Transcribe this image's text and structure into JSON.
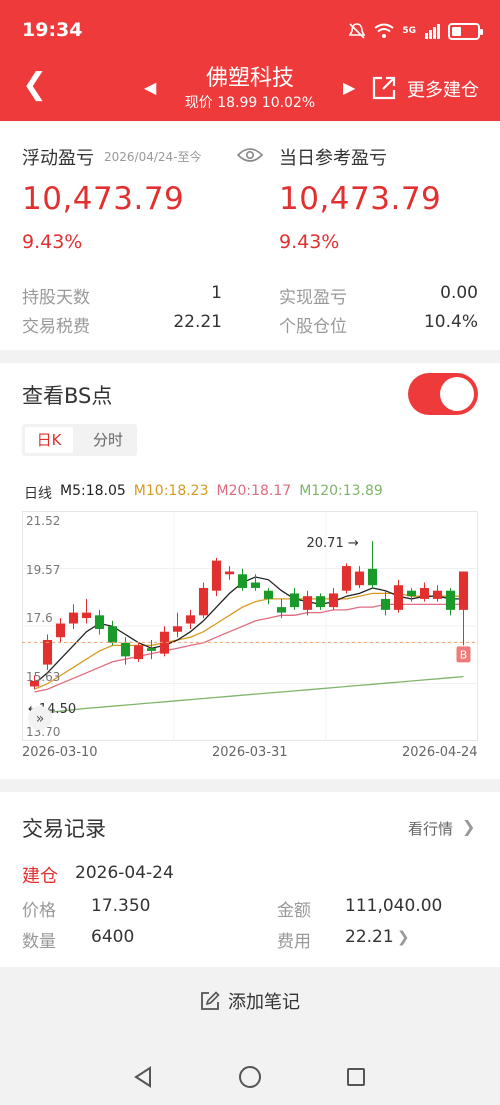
{
  "status": {
    "time": "19:34",
    "network": "5G"
  },
  "header": {
    "stock_name": "佛塑科技",
    "price_line": "现价 18.99 10.02%",
    "more": "更多建仓"
  },
  "pnl": {
    "floating_label": "浮动盈亏",
    "floating_range": "2026/04/24-至今",
    "floating_value": "10,473.79",
    "floating_pct": "9.43%",
    "daily_label": "当日参考盈亏",
    "daily_value": "10,473.79",
    "daily_pct": "9.43%"
  },
  "stats": {
    "days_label": "持股天数",
    "days_value": "1",
    "tax_label": "交易税费",
    "tax_value": "22.21",
    "realized_label": "实现盈亏",
    "realized_value": "0.00",
    "position_label": "个股仓位",
    "position_value": "10.4%"
  },
  "bs": {
    "title": "查看BS点",
    "tab_day": "日K",
    "tab_min": "分时",
    "ma_kind": "日线",
    "ma5": "M5:18.05",
    "ma10": "M10:18.23",
    "ma20": "M20:18.17",
    "ma120": "M120:13.89",
    "colors": {
      "ma5": "#222222",
      "ma10": "#d89a1e",
      "ma20": "#e06b7e",
      "ma120": "#7fb56a",
      "up": "#e23030",
      "down": "#1a9a2a"
    }
  },
  "chart_data": {
    "type": "candlestick",
    "y_ticks": [
      "21.52",
      "19.57",
      "17.6",
      "15.63",
      "13.70"
    ],
    "x_labels": [
      "2026-03-10",
      "2026-03-31",
      "2026-04-24"
    ],
    "ylim": [
      13.7,
      21.52
    ],
    "max_label": "20.71",
    "min_label": "14.50",
    "bs_marker": "B",
    "candles": [
      {
        "o": 15.4,
        "c": 15.6,
        "h": 15.8,
        "l": 15.3
      },
      {
        "o": 16.2,
        "c": 17.1,
        "h": 17.3,
        "l": 16.0
      },
      {
        "o": 17.2,
        "c": 17.7,
        "h": 17.9,
        "l": 17.0
      },
      {
        "o": 17.7,
        "c": 18.1,
        "h": 18.4,
        "l": 17.5
      },
      {
        "o": 17.9,
        "c": 18.1,
        "h": 18.6,
        "l": 17.7
      },
      {
        "o": 18.0,
        "c": 17.5,
        "h": 18.2,
        "l": 17.3
      },
      {
        "o": 17.6,
        "c": 17.0,
        "h": 17.8,
        "l": 16.9
      },
      {
        "o": 17.0,
        "c": 16.5,
        "h": 17.2,
        "l": 16.2
      },
      {
        "o": 16.4,
        "c": 16.9,
        "h": 17.0,
        "l": 16.3
      },
      {
        "o": 16.8,
        "c": 16.7,
        "h": 17.1,
        "l": 16.4
      },
      {
        "o": 16.6,
        "c": 17.4,
        "h": 17.6,
        "l": 16.5
      },
      {
        "o": 17.4,
        "c": 17.6,
        "h": 18.1,
        "l": 17.2
      },
      {
        "o": 17.7,
        "c": 18.0,
        "h": 18.2,
        "l": 17.5
      },
      {
        "o": 18.0,
        "c": 19.0,
        "h": 19.2,
        "l": 17.9
      },
      {
        "o": 18.9,
        "c": 20.0,
        "h": 20.1,
        "l": 18.7
      },
      {
        "o": 19.5,
        "c": 19.6,
        "h": 19.8,
        "l": 19.3
      },
      {
        "o": 19.5,
        "c": 19.0,
        "h": 19.7,
        "l": 18.9
      },
      {
        "o": 19.2,
        "c": 19.0,
        "h": 19.5,
        "l": 18.9
      },
      {
        "o": 18.9,
        "c": 18.6,
        "h": 19.0,
        "l": 18.4
      },
      {
        "o": 18.3,
        "c": 18.1,
        "h": 18.6,
        "l": 17.9
      },
      {
        "o": 18.8,
        "c": 18.3,
        "h": 19.0,
        "l": 18.2
      },
      {
        "o": 18.2,
        "c": 18.7,
        "h": 18.9,
        "l": 18.0
      },
      {
        "o": 18.7,
        "c": 18.3,
        "h": 18.8,
        "l": 18.2
      },
      {
        "o": 18.3,
        "c": 18.8,
        "h": 19.0,
        "l": 18.2
      },
      {
        "o": 18.9,
        "c": 19.8,
        "h": 19.9,
        "l": 18.8
      },
      {
        "o": 19.1,
        "c": 19.6,
        "h": 19.8,
        "l": 19.0
      },
      {
        "o": 19.7,
        "c": 19.1,
        "h": 20.71,
        "l": 19.0
      },
      {
        "o": 18.6,
        "c": 18.2,
        "h": 18.9,
        "l": 18.0
      },
      {
        "o": 18.2,
        "c": 19.1,
        "h": 19.3,
        "l": 18.1
      },
      {
        "o": 18.9,
        "c": 18.7,
        "h": 19.0,
        "l": 18.5
      },
      {
        "o": 18.6,
        "c": 19.0,
        "h": 19.2,
        "l": 18.5
      },
      {
        "o": 18.6,
        "c": 18.9,
        "h": 19.1,
        "l": 18.5
      },
      {
        "o": 18.9,
        "c": 18.2,
        "h": 19.0,
        "l": 18.0
      },
      {
        "o": 18.2,
        "c": 19.6,
        "h": 19.6,
        "l": 16.9
      }
    ],
    "ma5": [
      15.5,
      15.9,
      16.4,
      16.9,
      17.4,
      17.7,
      17.6,
      17.3,
      17.0,
      16.8,
      16.9,
      17.1,
      17.4,
      17.8,
      18.3,
      18.8,
      19.2,
      19.4,
      19.3,
      18.9,
      18.6,
      18.5,
      18.4,
      18.5,
      18.7,
      18.8,
      19.0,
      18.9,
      18.7,
      18.6,
      18.7,
      18.7,
      18.6,
      18.6
    ],
    "ma10": [
      15.3,
      15.5,
      15.8,
      16.1,
      16.4,
      16.7,
      16.9,
      16.9,
      16.9,
      16.9,
      17.0,
      17.1,
      17.2,
      17.4,
      17.7,
      18.0,
      18.3,
      18.5,
      18.6,
      18.6,
      18.6,
      18.6,
      18.6,
      18.6,
      18.6,
      18.7,
      18.8,
      18.8,
      18.8,
      18.7,
      18.7,
      18.7,
      18.7,
      18.7
    ],
    "ma20": [
      15.2,
      15.3,
      15.5,
      15.7,
      15.9,
      16.1,
      16.3,
      16.4,
      16.5,
      16.6,
      16.7,
      16.8,
      16.9,
      17.0,
      17.2,
      17.4,
      17.6,
      17.8,
      17.9,
      18.0,
      18.0,
      18.1,
      18.1,
      18.2,
      18.2,
      18.3,
      18.3,
      18.4,
      18.4,
      18.4,
      18.4,
      18.4,
      18.4,
      18.4
    ],
    "ma120": [
      14.4,
      14.45,
      14.5,
      14.55,
      14.6,
      14.64,
      14.68,
      14.72,
      14.76,
      14.8,
      14.84,
      14.88,
      14.92,
      14.96,
      15.0,
      15.04,
      15.08,
      15.12,
      15.16,
      15.2,
      15.24,
      15.28,
      15.32,
      15.36,
      15.4,
      15.44,
      15.48,
      15.52,
      15.56,
      15.6,
      15.64,
      15.68,
      15.72,
      15.76
    ]
  },
  "trade": {
    "title": "交易记录",
    "market_link": "看行情",
    "type": "建仓",
    "date": "2026-04-24",
    "price_label": "价格",
    "price_value": "17.350",
    "amount_label": "金额",
    "amount_value": "111,040.00",
    "qty_label": "数量",
    "qty_value": "6400",
    "fee_label": "费用",
    "fee_value": "22.21"
  },
  "note": {
    "label": "添加笔记"
  }
}
